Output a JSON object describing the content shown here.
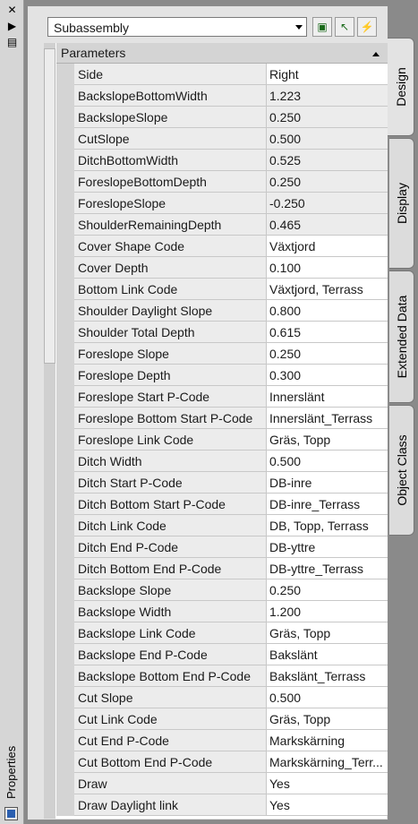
{
  "palette_title": "Properties",
  "toolbar": {
    "dropdown_value": "Subassembly"
  },
  "category": "Parameters",
  "tabs": [
    "Design",
    "Display",
    "Extended Data",
    "Object Class"
  ],
  "rows": [
    {
      "name": "Side",
      "value": "Right",
      "editable": true
    },
    {
      "name": "BackslopeBottomWidth",
      "value": "1.223",
      "editable": false
    },
    {
      "name": "BackslopeSlope",
      "value": "0.250",
      "editable": false
    },
    {
      "name": "CutSlope",
      "value": "0.500",
      "editable": false
    },
    {
      "name": "DitchBottomWidth",
      "value": "0.525",
      "editable": false
    },
    {
      "name": "ForeslopeBottomDepth",
      "value": "0.250",
      "editable": false
    },
    {
      "name": "ForeslopeSlope",
      "value": "-0.250",
      "editable": false
    },
    {
      "name": "ShoulderRemainingDepth",
      "value": "0.465",
      "editable": false
    },
    {
      "name": "Cover Shape Code",
      "value": "Växtjord",
      "editable": true
    },
    {
      "name": "Cover Depth",
      "value": "0.100",
      "editable": true
    },
    {
      "name": "Bottom Link Code",
      "value": "Växtjord, Terrass",
      "editable": true
    },
    {
      "name": "Shoulder Daylight Slope",
      "value": "0.800",
      "editable": true
    },
    {
      "name": "Shoulder Total Depth",
      "value": "0.615",
      "editable": true
    },
    {
      "name": "Foreslope Slope",
      "value": "0.250",
      "editable": true
    },
    {
      "name": "Foreslope Depth",
      "value": "0.300",
      "editable": true
    },
    {
      "name": "Foreslope Start P-Code",
      "value": "Innerslänt",
      "editable": true
    },
    {
      "name": "Foreslope Bottom Start P-Code",
      "value": "Innerslänt_Terrass",
      "editable": true
    },
    {
      "name": "Foreslope Link Code",
      "value": "Gräs, Topp",
      "editable": true
    },
    {
      "name": "Ditch Width",
      "value": "0.500",
      "editable": true
    },
    {
      "name": "Ditch Start P-Code",
      "value": "DB-inre",
      "editable": true
    },
    {
      "name": "Ditch Bottom Start P-Code",
      "value": "DB-inre_Terrass",
      "editable": true
    },
    {
      "name": "Ditch Link Code",
      "value": "DB, Topp, Terrass",
      "editable": true
    },
    {
      "name": "Ditch End P-Code",
      "value": "DB-yttre",
      "editable": true
    },
    {
      "name": "Ditch Bottom End P-Code",
      "value": "DB-yttre_Terrass",
      "editable": true
    },
    {
      "name": "Backslope Slope",
      "value": "0.250",
      "editable": true
    },
    {
      "name": "Backslope Width",
      "value": "1.200",
      "editable": true
    },
    {
      "name": "Backslope Link Code",
      "value": "Gräs, Topp",
      "editable": true
    },
    {
      "name": "Backslope End P-Code",
      "value": "Bakslänt",
      "editable": true
    },
    {
      "name": "Backslope Bottom End P-Code",
      "value": "Bakslänt_Terrass",
      "editable": true
    },
    {
      "name": "Cut Slope",
      "value": "0.500",
      "editable": true
    },
    {
      "name": "Cut Link Code",
      "value": "Gräs, Topp",
      "editable": true
    },
    {
      "name": "Cut End P-Code",
      "value": "Markskärning",
      "editable": true
    },
    {
      "name": "Cut Bottom End P-Code",
      "value": "Markskärning_Terr...",
      "editable": true
    },
    {
      "name": "Draw",
      "value": "Yes",
      "editable": true
    },
    {
      "name": "Draw Daylight link",
      "value": "Yes",
      "editable": true
    }
  ]
}
